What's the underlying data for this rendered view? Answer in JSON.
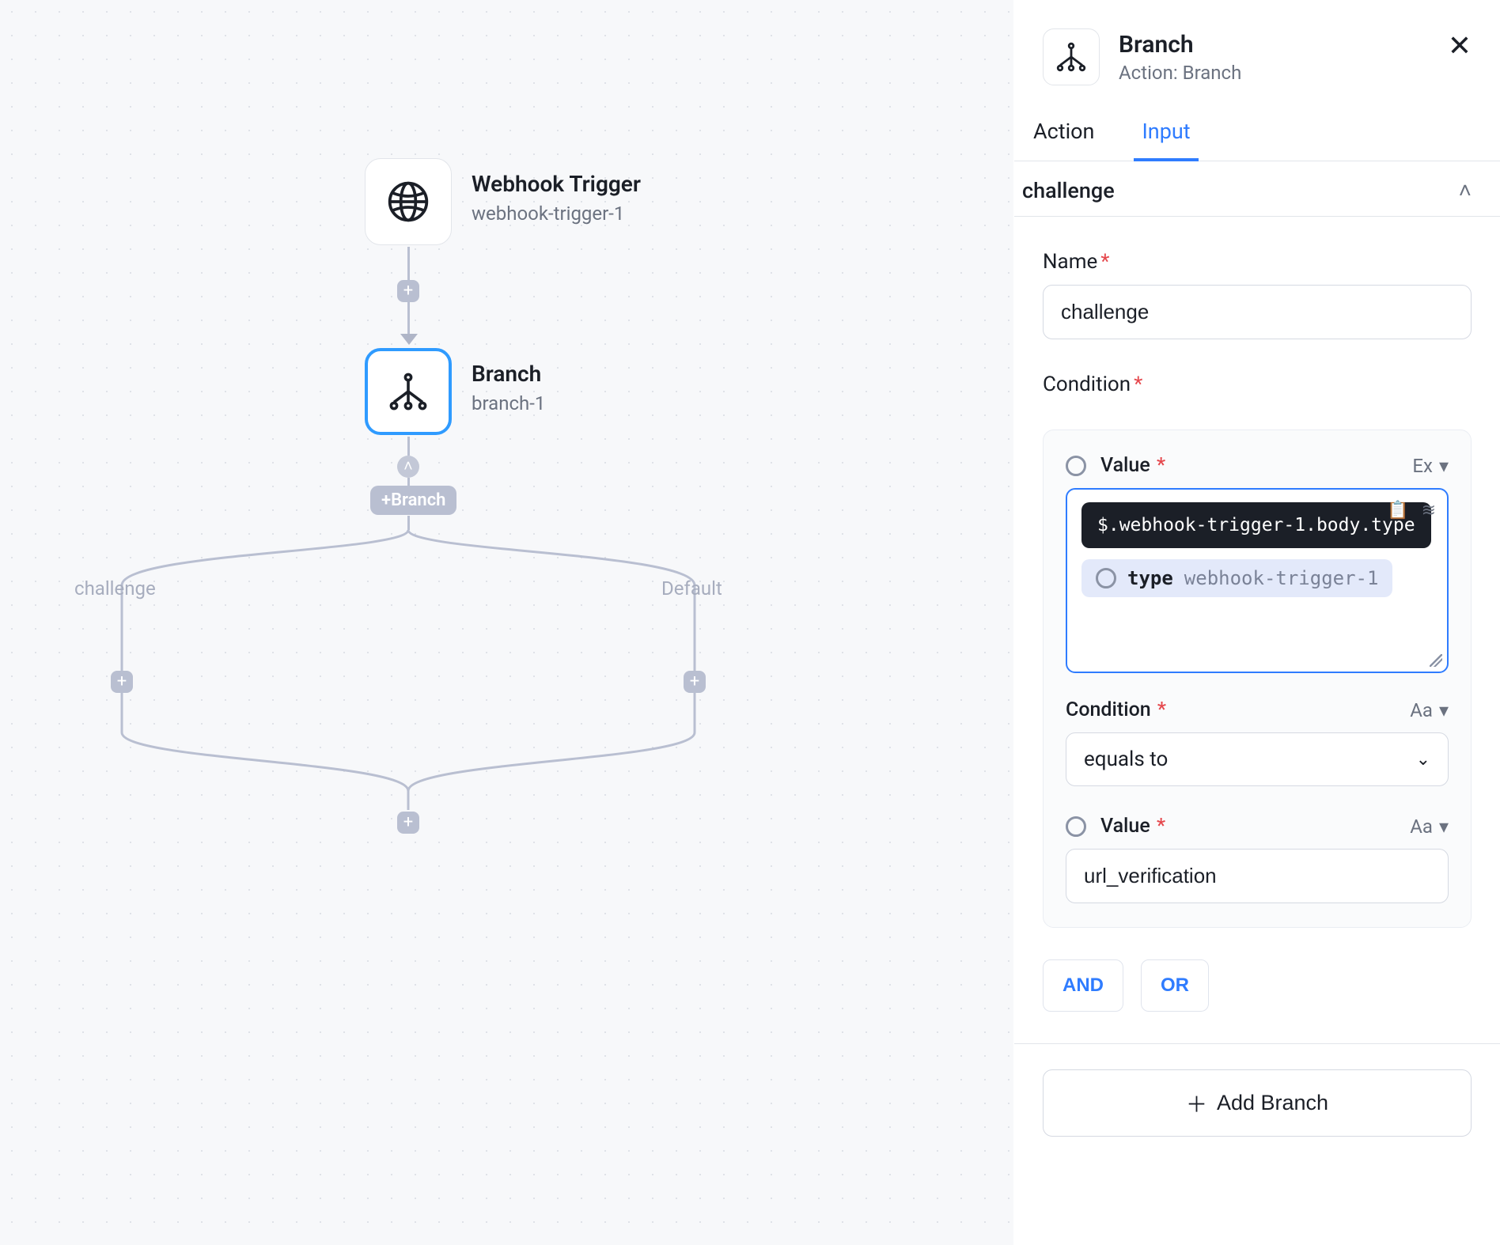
{
  "canvas": {
    "nodes": [
      {
        "title": "Webhook Trigger",
        "sub": "webhook-trigger-1"
      },
      {
        "title": "Branch",
        "sub": "branch-1"
      }
    ],
    "add_branch_chip": "+Branch",
    "lanes": {
      "left": "challenge",
      "right": "Default"
    }
  },
  "panel": {
    "title": "Branch",
    "subtitle": "Action: Branch",
    "tabs": {
      "action": "Action",
      "input": "Input"
    },
    "active_tab": "Input",
    "section": "challenge",
    "name_label": "Name",
    "name_value": "challenge",
    "condition_label": "Condition",
    "card": {
      "value1_label": "Value",
      "value1_hint": "Ex",
      "tooltip": "$.webhook-trigger-1.body.type",
      "chip_key": "type",
      "chip_src": "webhook-trigger-1",
      "cond_label": "Condition",
      "cond_hint": "Aa",
      "cond_value": "equals to",
      "value2_label": "Value",
      "value2_hint": "Aa",
      "value2_value": "url_verification"
    },
    "logic": {
      "and": "AND",
      "or": "OR"
    },
    "add_branch": "Add Branch"
  }
}
